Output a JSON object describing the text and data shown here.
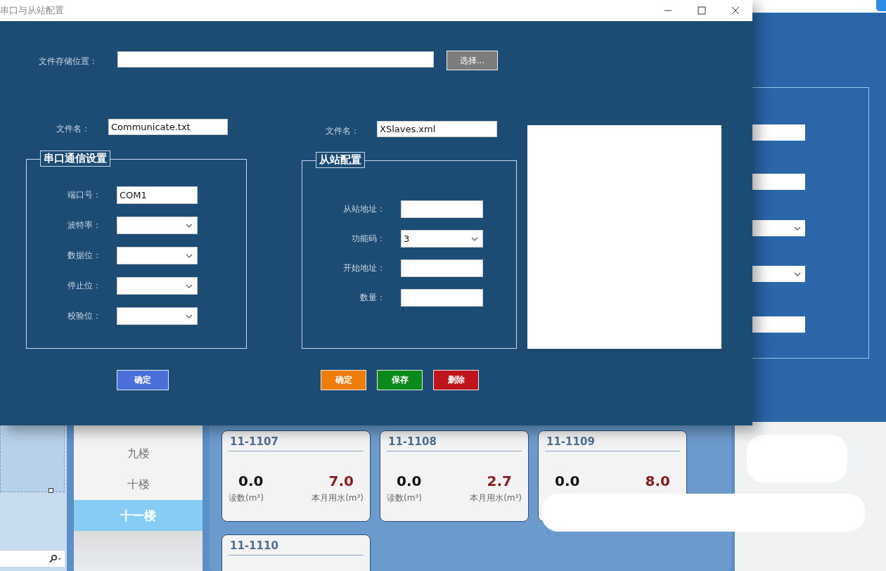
{
  "dialog": {
    "title": "串口与从站配置",
    "storage": {
      "label": "文件存储位置：",
      "button": "选择..."
    },
    "serial": {
      "file_label": "文件名：",
      "file_value": "Communicate.txt",
      "group_title": "串口通信设置",
      "fields": [
        {
          "label": "端口号：",
          "kind": "text",
          "value": "COM1"
        },
        {
          "label": "波特率：",
          "kind": "dropdown"
        },
        {
          "label": "数据位：",
          "kind": "dropdown"
        },
        {
          "label": "停止位：",
          "kind": "dropdown"
        },
        {
          "label": "校验位：",
          "kind": "dropdown"
        }
      ],
      "buttons": [
        {
          "label": "确定",
          "color": "#4a6fd8"
        }
      ]
    },
    "slave": {
      "file_label": "文件名：",
      "file_value": "XSlaves.xml",
      "group_title": "从站配置",
      "fields": [
        {
          "label": "从站地址：",
          "kind": "text"
        },
        {
          "label": "功能码：",
          "kind": "dropdown",
          "value": "3"
        },
        {
          "label": "开始地址：",
          "kind": "text"
        },
        {
          "label": "数量：",
          "kind": "text"
        }
      ],
      "buttons": [
        {
          "label": "确定",
          "color": "#f07c0a"
        },
        {
          "label": "保存",
          "color": "#0a8a1a"
        },
        {
          "label": "删除",
          "color": "#c0141c"
        }
      ]
    }
  },
  "background": {
    "side_fields": [
      {
        "kind": "text"
      },
      {
        "kind": "text"
      },
      {
        "kind": "dropdown"
      },
      {
        "kind": "dropdown"
      },
      {
        "kind": "text"
      }
    ],
    "floors": [
      {
        "label": "九楼",
        "selected": false
      },
      {
        "label": "十楼",
        "selected": false
      },
      {
        "label": "十一楼",
        "selected": true
      }
    ],
    "meters": [
      {
        "title": "11-1107",
        "reading": "0.0",
        "reading_label": "读数(m³)",
        "usage": "7.0",
        "usage_label": "本月用水(m³)"
      },
      {
        "title": "11-1108",
        "reading": "0.0",
        "reading_label": "读数(m³)",
        "usage": "2.7",
        "usage_label": "本月用水(m³)"
      },
      {
        "title": "11-1109",
        "reading": "0.0",
        "usage": "8.0"
      },
      {
        "title": "11-1110"
      }
    ]
  }
}
